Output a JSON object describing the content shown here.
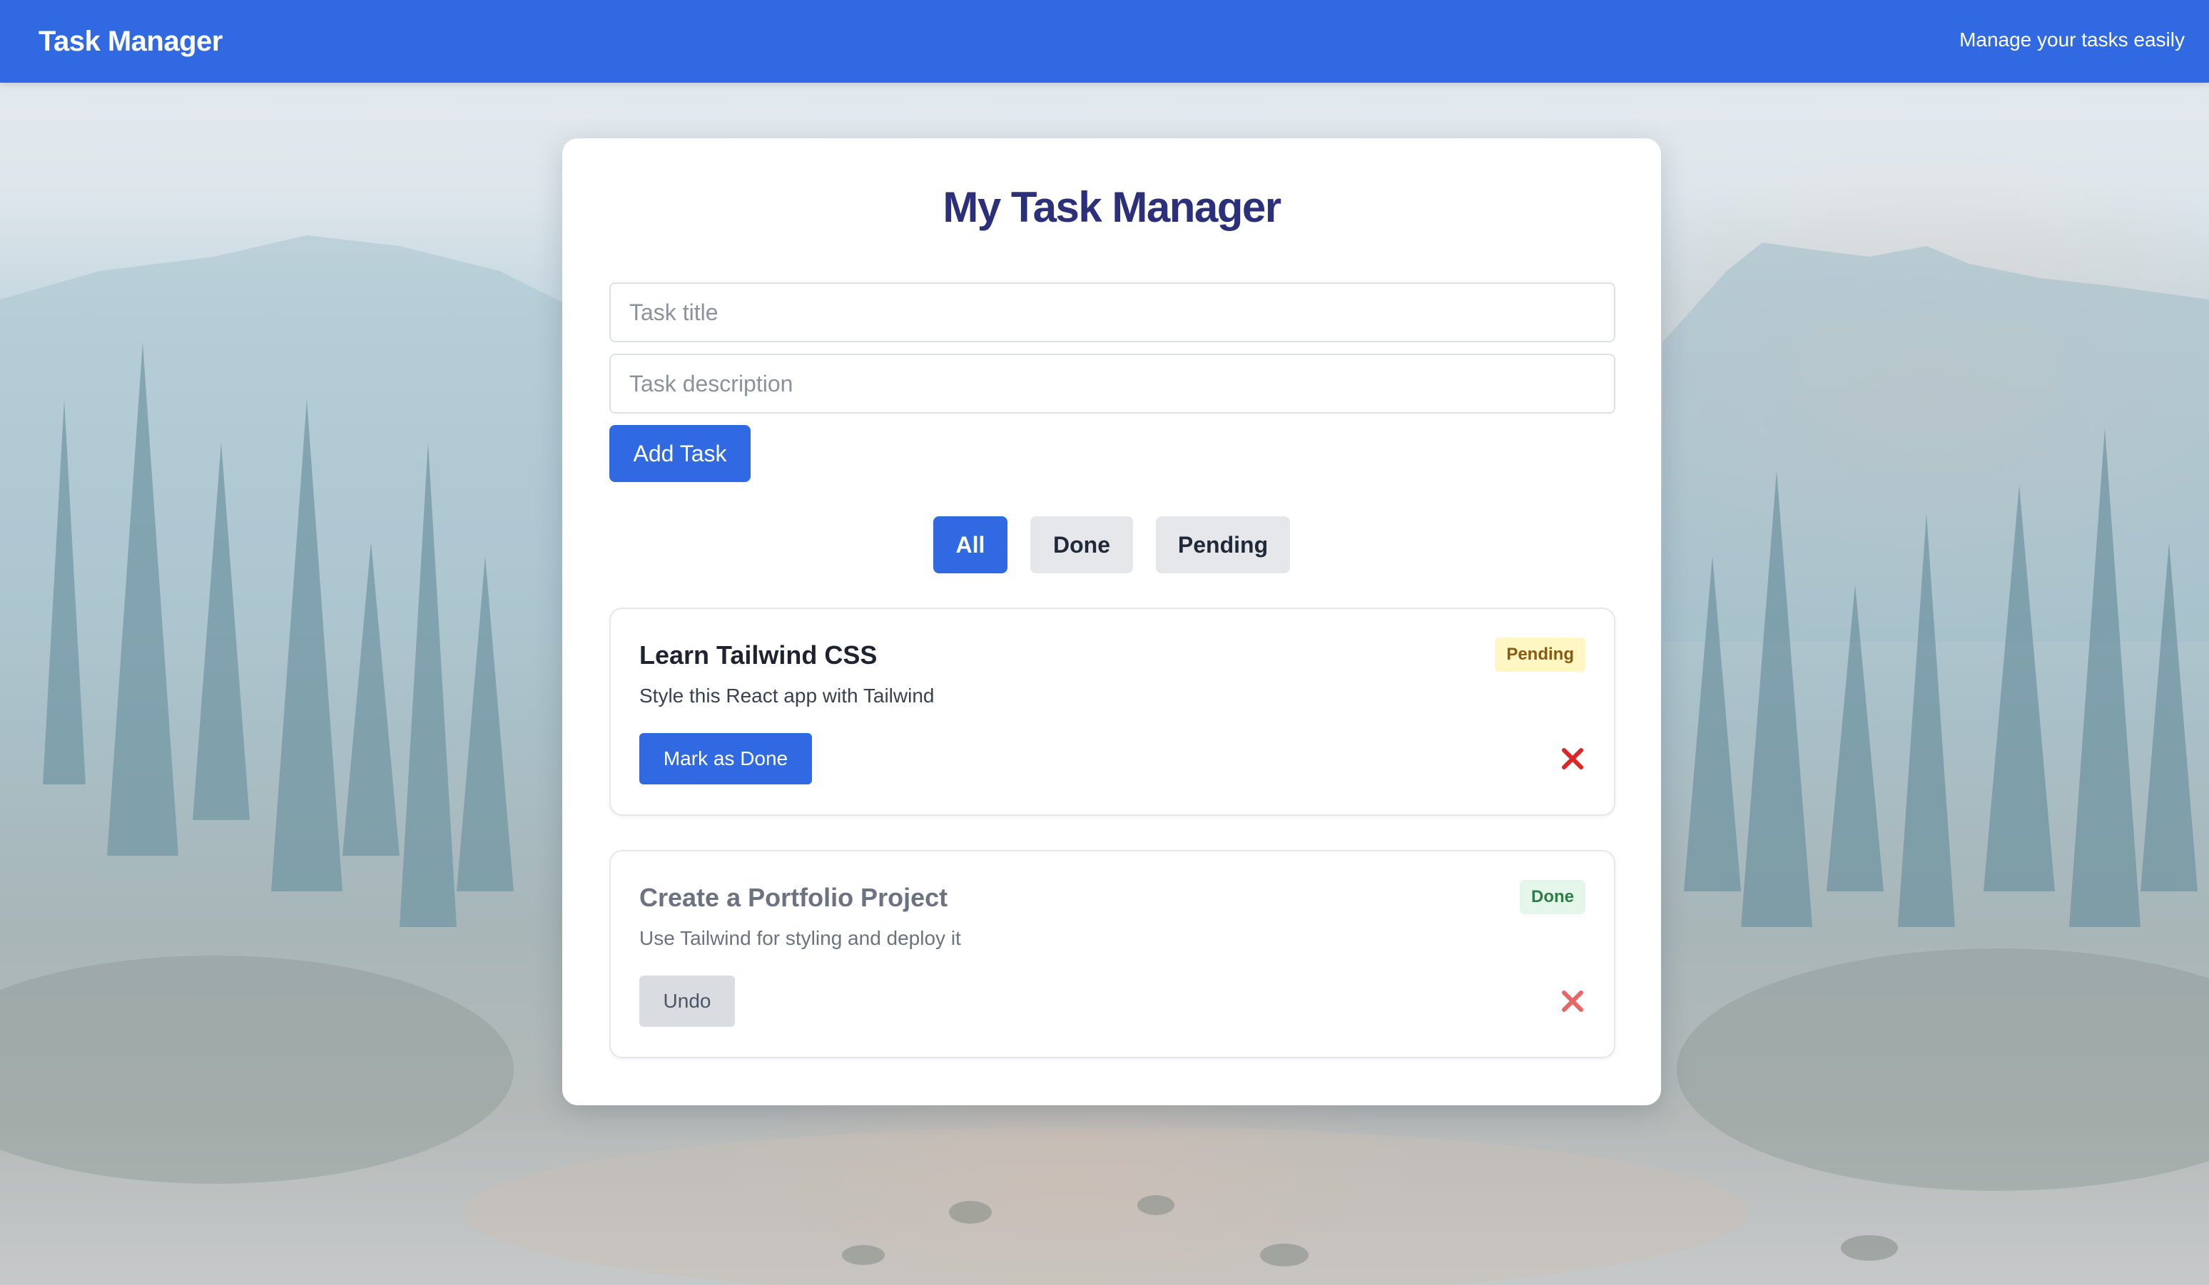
{
  "navbar": {
    "brand": "Task Manager",
    "tagline": "Manage your tasks easily",
    "color": "#3169e3"
  },
  "main": {
    "title": "My Task Manager",
    "form": {
      "title_placeholder": "Task title",
      "title_value": "",
      "description_placeholder": "Task description",
      "description_value": "",
      "add_label": "Add Task"
    },
    "filters": [
      {
        "label": "All",
        "active": true
      },
      {
        "label": "Done",
        "active": false
      },
      {
        "label": "Pending",
        "active": false
      }
    ],
    "tasks": [
      {
        "title": "Learn Tailwind CSS",
        "description": "Style this React app with Tailwind",
        "status": "Pending",
        "action_label": "Mark as Done",
        "delete_icon": "close-icon"
      },
      {
        "title": "Create a Portfolio Project",
        "description": "Use Tailwind for styling and deploy it",
        "status": "Done",
        "action_label": "Undo",
        "delete_icon": "close-icon"
      }
    ]
  },
  "colors": {
    "primary": "#3169e3",
    "title": "#2c2f7a",
    "delete": "#dc2626",
    "pending_badge_bg": "#fef6c3",
    "done_badge_bg": "#e5f6ea"
  }
}
